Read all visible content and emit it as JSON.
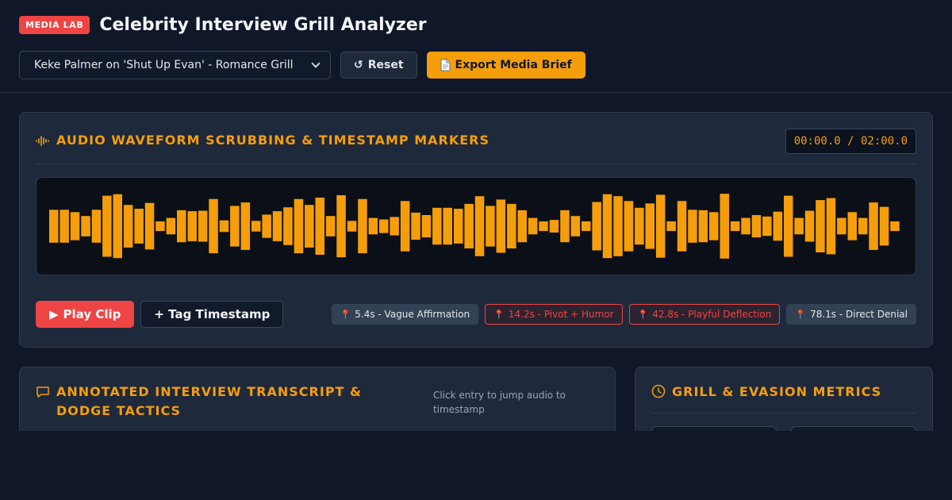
{
  "header": {
    "badge": "MEDIA LAB",
    "title": "Celebrity Interview Grill Analyzer",
    "select_value": "Keke Palmer on 'Shut Up Evan' - Romance Grill",
    "reset_label": "Reset",
    "export_label": "Export Media Brief"
  },
  "waveform_panel": {
    "title": "Audio Waveform Scrubbing & Timestamp Markers",
    "timecode": "00:00.0 / 02:00.0",
    "play_label": "Play Clip",
    "tag_label": "+ Tag Timestamp",
    "markers": [
      {
        "label": "5.4s - Vague Affirmation",
        "highlighted": false
      },
      {
        "label": "14.2s - Pivot + Humor",
        "highlighted": true
      },
      {
        "label": "42.8s - Playful Deflection",
        "highlighted": true
      },
      {
        "label": "78.1s - Direct Denial",
        "highlighted": false
      }
    ],
    "bar_levels": [
      0.34,
      0.34,
      0.29,
      0.21,
      0.34,
      0.63,
      0.66,
      0.44,
      0.36,
      0.48,
      0.1,
      0.17,
      0.33,
      0.31,
      0.32,
      0.56,
      0.12,
      0.42,
      0.49,
      0.11,
      0.24,
      0.31,
      0.39,
      0.56,
      0.44,
      0.59,
      0.21,
      0.64,
      0.11,
      0.56,
      0.17,
      0.14,
      0.19,
      0.52,
      0.28,
      0.23,
      0.38,
      0.38,
      0.36,
      0.46,
      0.62,
      0.42,
      0.55,
      0.46,
      0.33,
      0.17,
      0.1,
      0.13,
      0.33,
      0.21,
      0.1,
      0.5,
      0.66,
      0.62,
      0.52,
      0.38,
      0.47,
      0.65,
      0.1,
      0.52,
      0.34,
      0.33,
      0.29,
      0.67,
      0.1,
      0.17,
      0.23,
      0.2,
      0.3,
      0.63,
      0.17,
      0.32,
      0.54,
      0.58,
      0.17,
      0.29,
      0.17,
      0.49,
      0.4,
      0.1
    ],
    "bar_color": "#f59e0b"
  },
  "transcript_panel": {
    "title": "Annotated Interview Transcript & Dodge Tactics",
    "hint": "Click entry to jump audio to timestamp"
  },
  "metrics_panel": {
    "title": "Grill & Evasion Metrics"
  },
  "colors": {
    "accent": "#f59e0b",
    "alert": "#ef4444",
    "background": "#0f1729"
  }
}
